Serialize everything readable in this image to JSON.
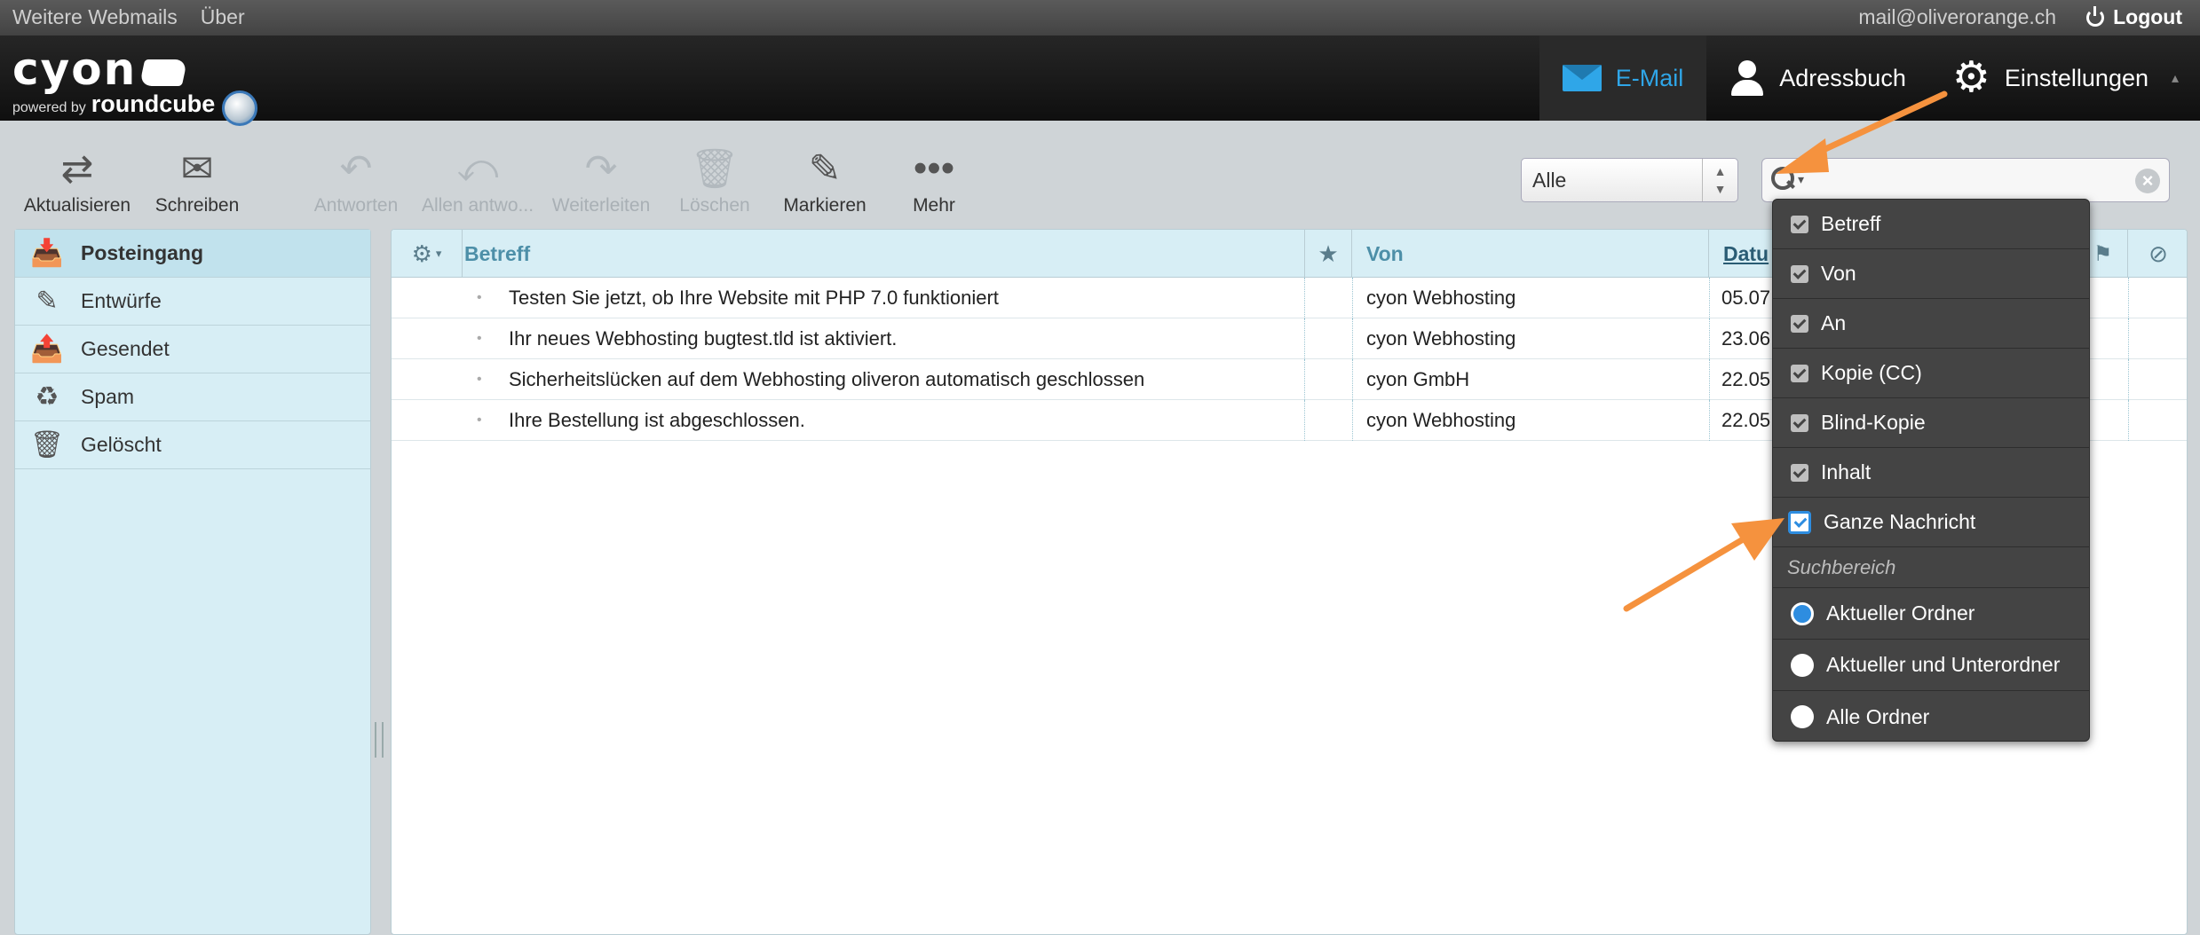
{
  "topline": {
    "links": [
      "Weitere Webmails",
      "Über"
    ],
    "user_email": "mail@oliverorange.ch",
    "logout_label": "Logout"
  },
  "logo": {
    "brand": "cyon",
    "powered_by": "powered by",
    "powered_product": "roundcube"
  },
  "nav": [
    {
      "label": "E-Mail",
      "icon": "envelope-icon",
      "active": true
    },
    {
      "label": "Adressbuch",
      "icon": "person-icon",
      "active": false
    },
    {
      "label": "Einstellungen",
      "icon": "gear-icon",
      "active": false
    }
  ],
  "toolbar": {
    "refresh": "Aktualisieren",
    "compose": "Schreiben",
    "reply": "Antworten",
    "reply_all": "Allen antwo...",
    "forward": "Weiterleiten",
    "delete": "Löschen",
    "mark": "Markieren",
    "more": "Mehr"
  },
  "filter": {
    "value": "Alle"
  },
  "folders": [
    {
      "label": "Posteingang",
      "icon": "inbox-icon",
      "selected": true
    },
    {
      "label": "Entwürfe",
      "icon": "pencil-icon",
      "selected": false
    },
    {
      "label": "Gesendet",
      "icon": "sent-icon",
      "selected": false
    },
    {
      "label": "Spam",
      "icon": "spam-icon",
      "selected": false
    },
    {
      "label": "Gelöscht",
      "icon": "trash-icon",
      "selected": false
    }
  ],
  "message_list": {
    "columns": {
      "subject": "Betreff",
      "from": "Von",
      "date": "Datu"
    },
    "rows": [
      {
        "subject": "Testen Sie jetzt, ob Ihre Website mit PHP 7.0 funktioniert",
        "from": "cyon Webhosting",
        "date": "05.07"
      },
      {
        "subject": "Ihr neues Webhosting bugtest.tld ist aktiviert.",
        "from": "cyon Webhosting",
        "date": "23.06"
      },
      {
        "subject": "Sicherheitslücken auf dem Webhosting oliveron automatisch geschlossen",
        "from": "cyon GmbH",
        "date": "22.05"
      },
      {
        "subject": "Ihre Bestellung ist abgeschlossen.",
        "from": "cyon Webhosting",
        "date": "22.05"
      }
    ]
  },
  "search_menu": {
    "fields": [
      {
        "label": "Betreff",
        "checked": true
      },
      {
        "label": "Von",
        "checked": true
      },
      {
        "label": "An",
        "checked": true
      },
      {
        "label": "Kopie (CC)",
        "checked": true
      },
      {
        "label": "Blind-Kopie",
        "checked": true
      },
      {
        "label": "Inhalt",
        "checked": true
      },
      {
        "label": "Ganze Nachricht",
        "checked": true
      }
    ],
    "scope_title": "Suchbereich",
    "scopes": [
      {
        "label": "Aktueller Ordner",
        "selected": true
      },
      {
        "label": "Aktueller und Unterordner",
        "selected": false
      },
      {
        "label": "Alle Ordner",
        "selected": false
      }
    ]
  },
  "colors": {
    "accent": "#2fa6e8",
    "annotation_arrow": "#f5923e",
    "folder_bg": "#d7eef5",
    "menu_bg": "#444444"
  }
}
